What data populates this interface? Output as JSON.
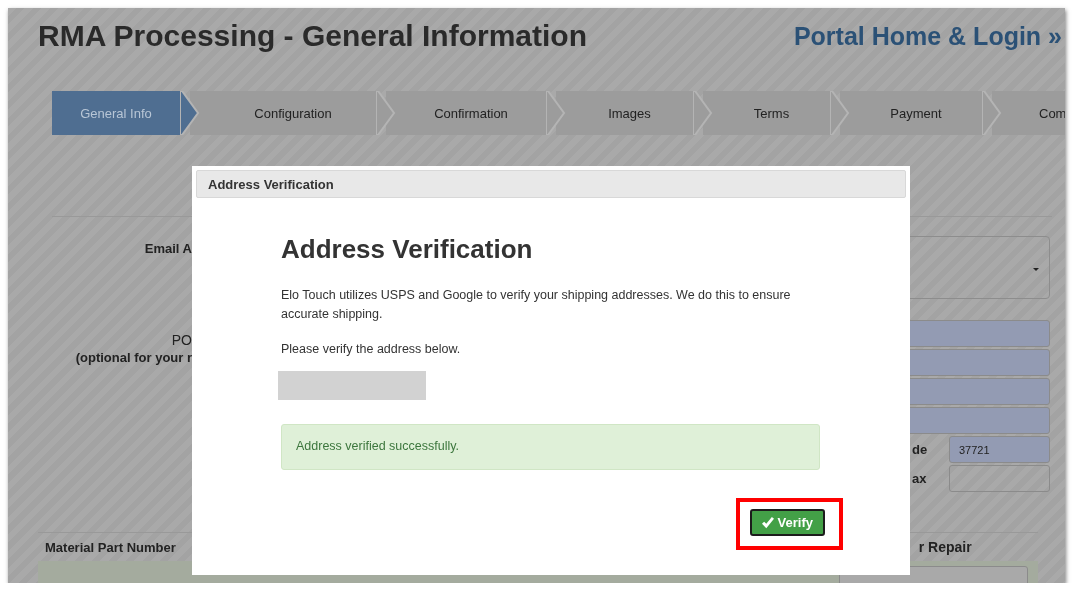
{
  "page": {
    "title": "RMA Processing - General Information",
    "portal_link": "Portal Home & Login »"
  },
  "steps": [
    {
      "label": "General Info",
      "selected": true
    },
    {
      "label": "Configuration",
      "selected": false
    },
    {
      "label": "Confirmation",
      "selected": false
    },
    {
      "label": "Images",
      "selected": false
    },
    {
      "label": "Terms",
      "selected": false
    },
    {
      "label": "Payment",
      "selected": false
    },
    {
      "label": "Com",
      "selected": false
    }
  ],
  "form": {
    "labels": [
      "Email A",
      "PO",
      "(optional for your r"
    ],
    "fields": [
      {
        "kind": "select",
        "autofilled": false
      },
      {
        "kind": "input",
        "autofilled": true
      },
      {
        "kind": "input",
        "autofilled": true
      },
      {
        "kind": "input",
        "autofilled": true
      },
      {
        "kind": "input",
        "autofilled": true
      },
      {
        "kind": "input",
        "label": "de",
        "value": "37721",
        "autofilled": true
      },
      {
        "kind": "input",
        "label": "ax",
        "autofilled": false
      }
    ]
  },
  "table": {
    "columns": [
      "Material Part Number",
      "r Repair"
    ],
    "rows": [
      {
        "kind": "cut"
      }
    ]
  },
  "modal": {
    "header": "Address Verification",
    "heading": "Address Verification",
    "paragraphs": [
      "Elo Touch utilizes USPS and Google to verify your shipping addresses. We do this to ensure accurate shipping.",
      "Please verify the address below."
    ],
    "alert": "Address verified successfully.",
    "button": "Verify",
    "button_highlighted": true
  }
}
